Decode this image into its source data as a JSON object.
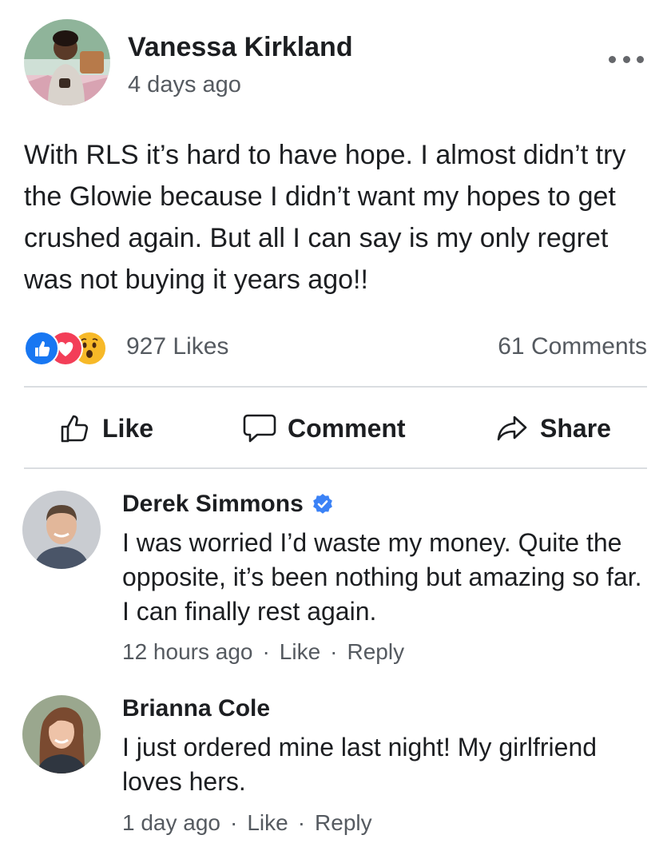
{
  "post": {
    "author": "Vanessa Kirkland",
    "time": "4 days ago",
    "text": "With RLS it’s hard to have hope. I almost didn’t try the Glowie because I didn’t want my hopes to get crushed again. But all I can say is my only regret was not buying it years ago!!",
    "likes": "927 Likes",
    "comments": "61 Comments",
    "reactions": [
      "like-icon",
      "love-icon",
      "wow-icon"
    ]
  },
  "actions": {
    "like": "Like",
    "comment": "Comment",
    "share": "Share"
  },
  "comments": [
    {
      "name": "Derek Simmons",
      "verified": true,
      "text": "I was worried I’d waste my money. Quite the opposite, it’s been nothing but amazing so far. I can finally rest again.",
      "time": "12 hours ago",
      "like": "Like",
      "reply": "Reply"
    },
    {
      "name": "Brianna Cole",
      "verified": false,
      "text": "I just ordered mine last night! My girlfriend loves hers.",
      "time": "1 day ago",
      "like": "Like",
      "reply": "Reply"
    }
  ],
  "colors": {
    "like_blue": "#1877f2",
    "love_red": "#f33e58",
    "wow_yellow": "#f7b928",
    "meta_gray": "#555a60",
    "divider": "#dadde1"
  }
}
